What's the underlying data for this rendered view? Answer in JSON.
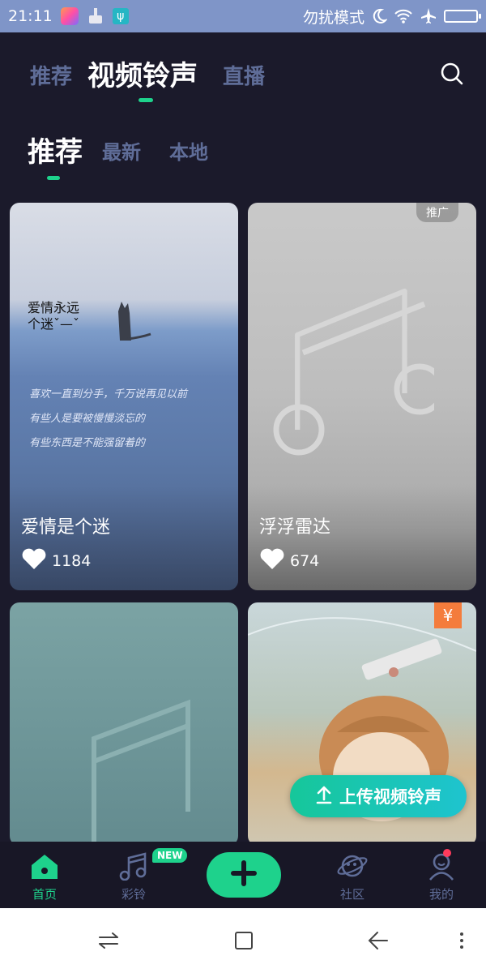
{
  "status_bar": {
    "time": "21:11",
    "dnd_text": "勿扰模式",
    "icons": [
      "app-icon",
      "broom-icon",
      "usb-icon",
      "moon-icon",
      "wifi-icon",
      "airplane-icon",
      "battery-icon"
    ]
  },
  "top_tabs": {
    "recommend": "推荐",
    "video_ringtone": "视频铃声",
    "live": "直播",
    "active": "视频铃声"
  },
  "sub_tabs": {
    "recommend": "推荐",
    "latest": "最新",
    "local": "本地",
    "active": "推荐"
  },
  "cards": [
    {
      "title": "爱情是个迷",
      "likes": "1184",
      "overlay_text_1": "爱情永远",
      "overlay_text_2": "个迷ˇ—ˇ",
      "poem_1": "喜欢一直到分手，千万说再见以前",
      "poem_2": "有些人是要被慢慢淡忘的",
      "poem_3": "有些东西是不能强留着的"
    },
    {
      "title": "浮浮雷达",
      "likes": "674",
      "badge": "推广"
    },
    {},
    {
      "badge": "¥"
    }
  ],
  "upload_button": {
    "label": "上传视频铃声"
  },
  "bottom_nav": {
    "home": "首页",
    "ringtone": "彩铃",
    "new_badge": "NEW",
    "community": "社区",
    "mine": "我的"
  },
  "colors": {
    "accent": "#1ed28c",
    "background": "#1b1a2b",
    "inactive": "#5f6d98",
    "status_bar": "#7f95c8"
  }
}
